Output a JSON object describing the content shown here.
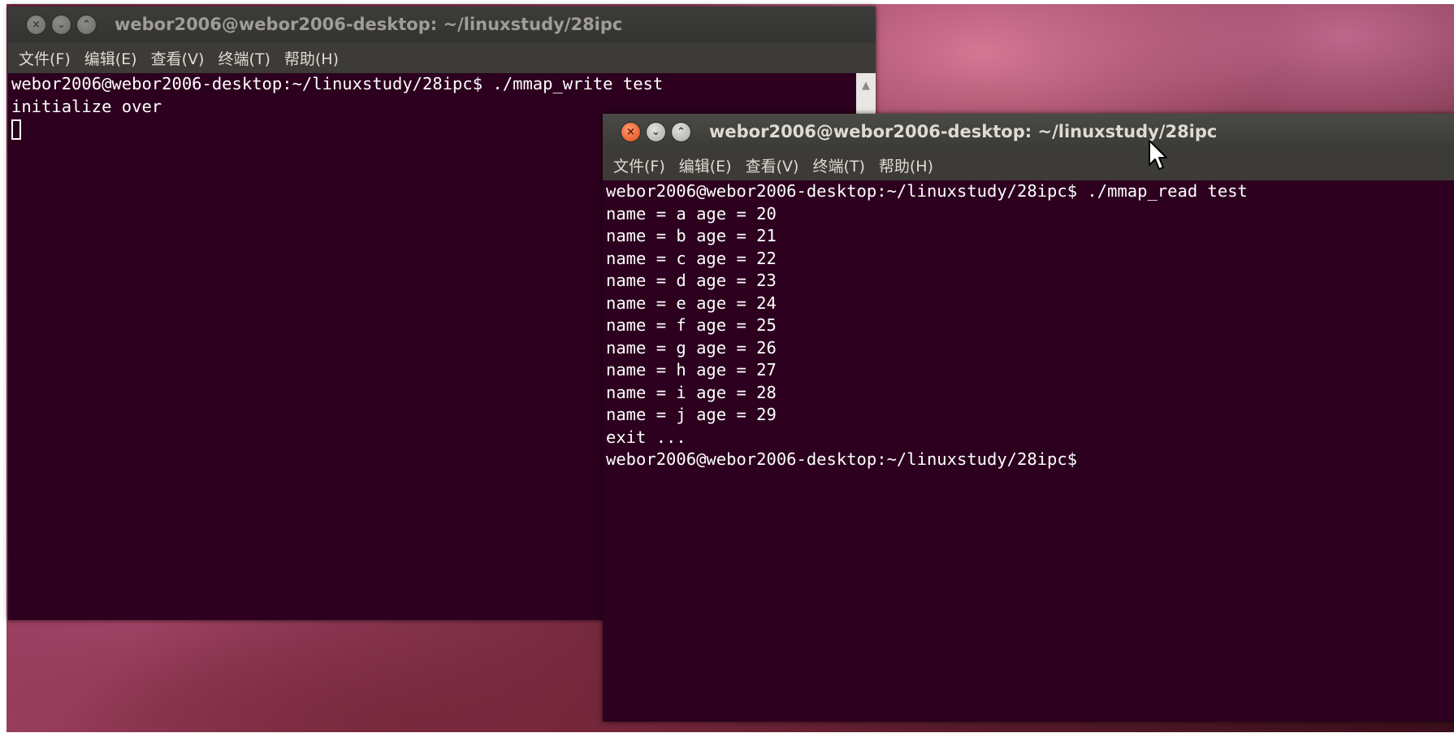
{
  "window1": {
    "title": "webor2006@webor2006-desktop: ~/linuxstudy/28ipc",
    "menu": [
      "文件(F)",
      "编辑(E)",
      "查看(V)",
      "终端(T)",
      "帮助(H)"
    ],
    "lines": [
      "webor2006@webor2006-desktop:~/linuxstudy/28ipc$ ./mmap_write test",
      "initialize over"
    ]
  },
  "window2": {
    "title": "webor2006@webor2006-desktop: ~/linuxstudy/28ipc",
    "menu": [
      "文件(F)",
      "编辑(E)",
      "查看(V)",
      "终端(T)",
      "帮助(H)"
    ],
    "lines": [
      "webor2006@webor2006-desktop:~/linuxstudy/28ipc$ ./mmap_read test",
      "name = a age = 20",
      "name = b age = 21",
      "name = c age = 22",
      "name = d age = 23",
      "name = e age = 24",
      "name = f age = 25",
      "name = g age = 26",
      "name = h age = 27",
      "name = i age = 28",
      "name = j age = 29",
      "exit ...",
      "webor2006@webor2006-desktop:~/linuxstudy/28ipc$"
    ]
  },
  "window_buttons": {
    "close": "×",
    "minimize": "⌄",
    "maximize": "⌃"
  },
  "scroll_up_glyph": "▲",
  "colors": {
    "terminal_bg": "#2c001e",
    "close_active": "#e0491c"
  }
}
